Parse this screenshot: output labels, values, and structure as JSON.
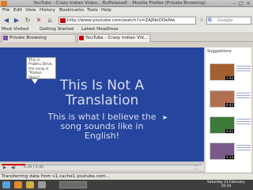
{
  "window": {
    "title": "YouTube - Crazy Indian Video... Buffalaxed! - Mozilla Firefox (Private Browsing)"
  },
  "menu": [
    "File",
    "Edit",
    "View",
    "History",
    "Bookmarks",
    "Tools",
    "Help"
  ],
  "navigation": {
    "url": "http://www.youtube.com/watch?v=ZAJNoOOeNw",
    "search_placeholder": "Google",
    "search_engine_initial": "G"
  },
  "bookmarks": [
    "Most Visited",
    "Getting Started",
    "Latest Headlines"
  ],
  "tabs": [
    {
      "label": "Private Browsing",
      "active": false,
      "icon": "mask-icon"
    },
    {
      "label": "YouTube - Crazy Indian Vid...",
      "active": true,
      "icon": "youtube-icon"
    }
  ],
  "video": {
    "annotation": "This is Prabhu Deva, the song is \"Kadun Vaani\"",
    "headline_line1": "This Is Not A",
    "headline_line2": "Translation",
    "sub_line1": "This is what I believe the",
    "sub_line2": "song sounds like in",
    "sub_line3": "English!",
    "background": "#25459f",
    "progress_fraction": 0.12,
    "time_display": "0:30 / 4:40"
  },
  "sidebar": {
    "heading": "Suggestions",
    "items": [
      {
        "duration": "1:52"
      },
      {
        "duration": "4:42"
      },
      {
        "duration": "3:21"
      },
      {
        "duration": "5:13"
      }
    ]
  },
  "status": {
    "text": "Transferring data from v1.cache1.youtube.com..."
  },
  "taskbar": {
    "clock_line1": "Saturday 21 February",
    "clock_line2": "10:34"
  },
  "colors": {
    "accent": "#cc0000",
    "taskbar": "#3f3f3f"
  }
}
